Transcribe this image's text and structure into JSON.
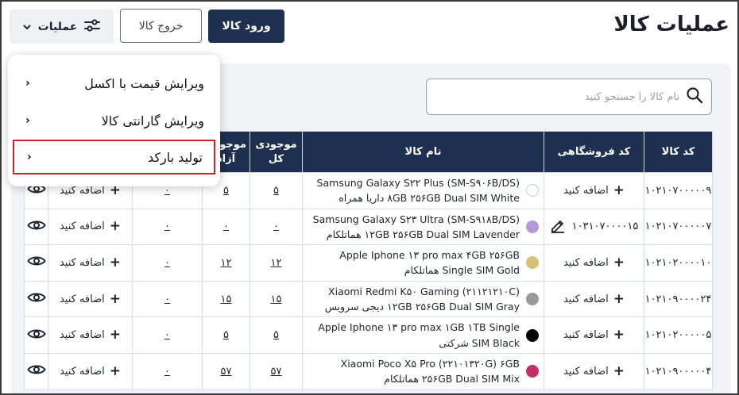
{
  "header": {
    "title": "عملیات کالا",
    "login_button": "ورود کالا",
    "exit_button": "خروج کالا",
    "operations_button": "عملیات"
  },
  "search": {
    "placeholder": "نام کالا را جستجو کنید"
  },
  "table": {
    "headers": {
      "code": "کد کالا",
      "shop_code": "کد فروشگاهی",
      "name": "نام کالا",
      "stock_total": "موجودی کل",
      "stock_free": "موجودی آزاد"
    },
    "add_label": "اضافه کنید",
    "rows": [
      {
        "code": "۱۰۲۱۰۷۰۰۰۰۰۹",
        "shop_code": "",
        "name_line1": "Samsung Galaxy S۲۲ Plus (SM-S۹۰۶B/DS)",
        "name_line2": "۸GB ۲۵۶GB Dual SIM White داریا همراه",
        "color": "#ffffff",
        "stock_total": "۵",
        "stock_free": "۵",
        "reserved": "۰"
      },
      {
        "code": "۱۰۲۱۰۷۰۰۰۰۰۷",
        "shop_code": "۱۰۳۱۰۷۰۰۰۰۱۵",
        "name_line1": "Samsung Galaxy S۲۳ Ultra (SM-S۹۱۸B/DS)",
        "name_line2": "۱۲GB ۲۵۶GB Dual SIM Lavender هماتلکام",
        "color": "#b39ad6",
        "stock_total": "۰",
        "stock_free": "۰",
        "reserved": "۰"
      },
      {
        "code": "۱۰۲۱۰۲۰۰۰۰۱۰",
        "shop_code": "",
        "name_line1": "Apple Iphone ۱۳ pro max ۴GB ۲۵۶GB",
        "name_line2": "Single SIM Gold هماتلکام",
        "color": "#d9c07a",
        "stock_total": "۱۲",
        "stock_free": "۱۲",
        "reserved": "۰"
      },
      {
        "code": "۱۰۲۱۰۹۰۰۰۰۲۴",
        "shop_code": "",
        "name_line1": "Xiaomi Redmi K۵۰ Gaming (۲۱۱۲۱۲۱۰C)",
        "name_line2": "۱۲GB ۲۵۶GB Dual SIM Gray دیجی سرویس",
        "color": "#9a9a9a",
        "stock_total": "۱۵",
        "stock_free": "۱۵",
        "reserved": "۰"
      },
      {
        "code": "۱۰۲۱۰۲۰۰۰۰۰۵",
        "shop_code": "",
        "name_line1": "Apple Iphone ۱۳ pro max ۱GB ۱TB Single",
        "name_line2": "SIM Black شرکتی",
        "color": "#000000",
        "stock_total": "۵",
        "stock_free": "۵",
        "reserved": "۰"
      },
      {
        "code": "۱۰۲۱۰۹۰۰۰۰۰۴",
        "shop_code": "",
        "name_line1": "Xiaomi Poco X۵ Pro (۲۲۱۰۱۳۲۰G) ۶GB",
        "name_line2": "۲۵۶GB Dual SIM Mix هماتلکام",
        "color": "#c0306a",
        "stock_total": "۵۷",
        "stock_free": "۵۷",
        "reserved": "۰"
      }
    ]
  },
  "dropdown": {
    "items": [
      {
        "label": "ویرایش قیمت با اکسل"
      },
      {
        "label": "ویرایش گارانتی کالا"
      },
      {
        "label": "تولید بارکد",
        "highlighted": true
      }
    ]
  },
  "colors": {
    "primary": "#1e3050",
    "highlight": "#d0202a",
    "panel": "#f1f3f6"
  },
  "icons": [
    "sliders-icon",
    "chevron-down-icon",
    "search-icon",
    "plus-icon",
    "edit-pencil-icon",
    "eye-icon",
    "chevron-left-icon"
  ]
}
